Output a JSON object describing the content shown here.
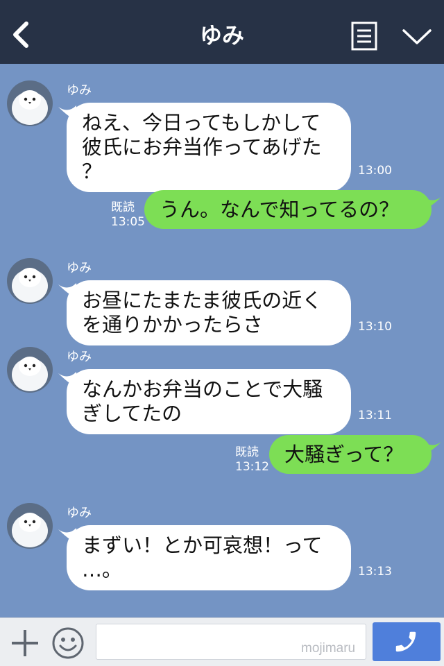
{
  "header": {
    "title": "ゆみ",
    "back_icon": "chevron-left",
    "menu_icon": "notes",
    "dropdown_icon": "chevron-down",
    "background": "#273246"
  },
  "chat": {
    "background": "#7494c4",
    "messages": [
      {
        "side": "in",
        "sender": "ゆみ",
        "lines": [
          "ねえ、今日ってもしかして",
          "彼氏にお弁当作ってあげた",
          "？"
        ],
        "time": "13:00"
      },
      {
        "side": "out",
        "text": "うん。なんで知ってるの？",
        "read": "既読",
        "time": "13:05"
      },
      {
        "side": "in",
        "sender": "ゆみ",
        "lines": [
          "お昼にたまたま彼氏の近く",
          "を通りかかったらさ"
        ],
        "time": "13:10"
      },
      {
        "side": "in",
        "sender": "ゆみ",
        "lines": [
          "なんかお弁当のことで大騒",
          "ぎしてたの"
        ],
        "time": "13:11"
      },
      {
        "side": "out",
        "text": "大騒ぎって？",
        "read": "既読",
        "time": "13:12"
      },
      {
        "side": "in",
        "sender": "ゆみ",
        "lines": [
          "まずい！とか可哀想！って",
          "…。"
        ],
        "time": "13:13"
      }
    ],
    "incoming_color": "#ffffff",
    "outgoing_color": "#7dde55"
  },
  "bottom_bar": {
    "plus_icon": "plus",
    "emoji_icon": "smiley-face",
    "input_value": "",
    "watermark": "mojimaru",
    "call_icon": "phone",
    "call_color": "#4f7fdb"
  }
}
